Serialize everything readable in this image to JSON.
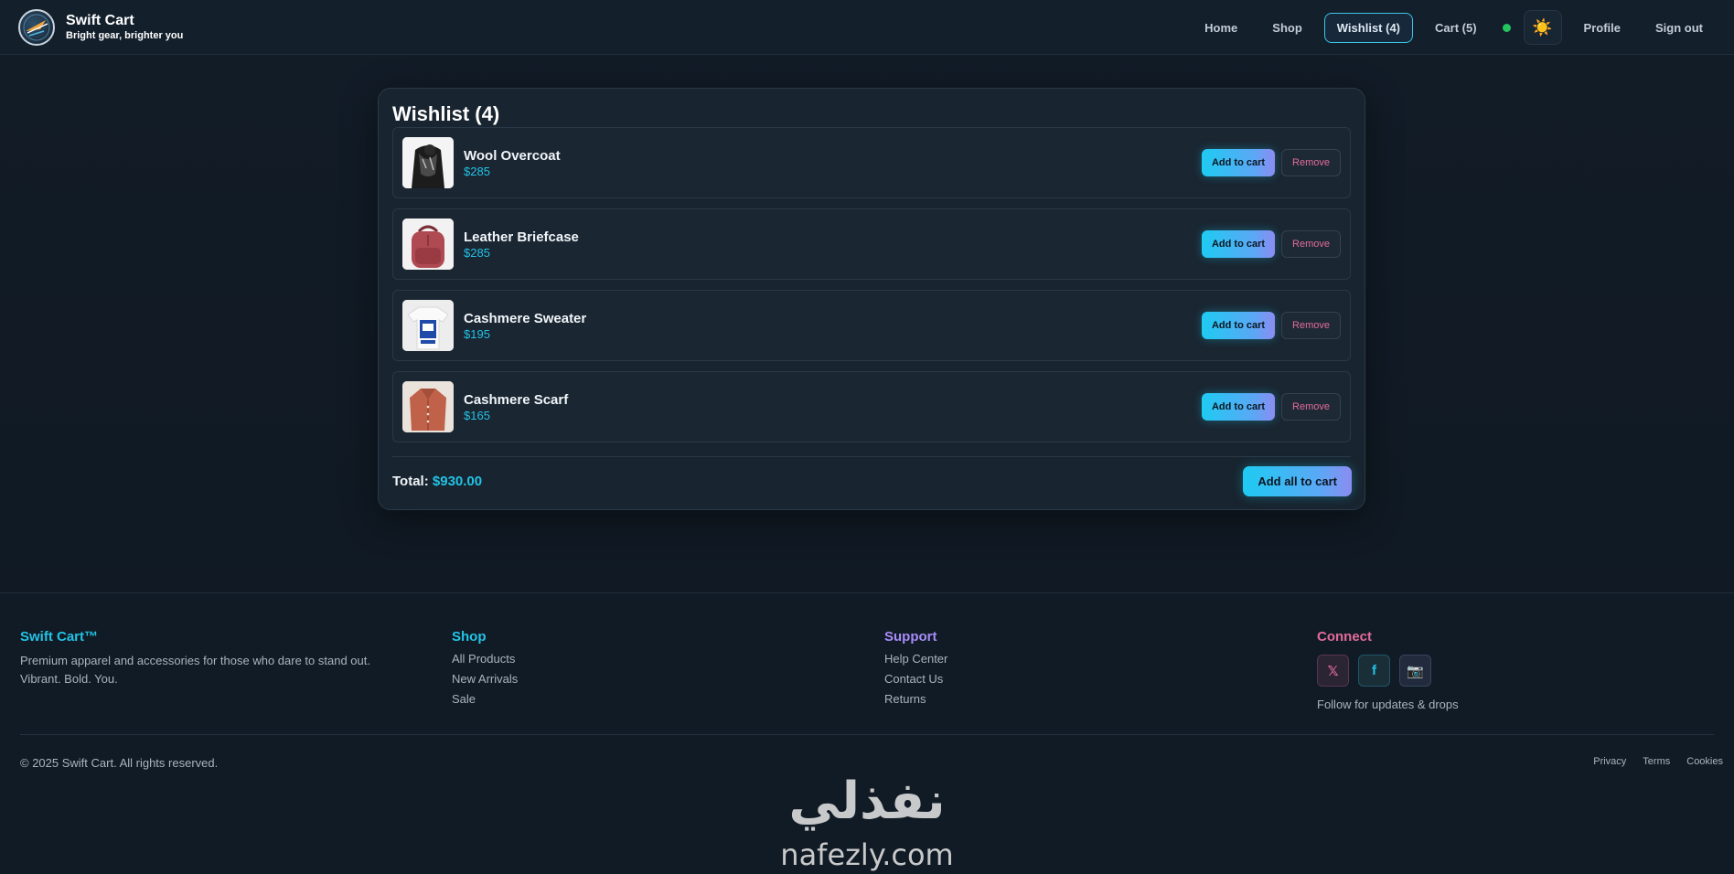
{
  "brand": {
    "name": "Swift Cart",
    "tagline": "Bright gear, brighter you"
  },
  "nav": {
    "home": "Home",
    "shop": "Shop",
    "wishlist": "Wishlist (4)",
    "cart": "Cart (5)",
    "theme_icon": "☀️",
    "profile": "Profile",
    "signout": "Sign out"
  },
  "wishlist": {
    "title": "Wishlist (4)",
    "items": [
      {
        "name": "Wool Overcoat",
        "price": "$285",
        "add_label": "Add to cart",
        "remove_label": "Remove"
      },
      {
        "name": "Leather Briefcase",
        "price": "$285",
        "add_label": "Add to cart",
        "remove_label": "Remove"
      },
      {
        "name": "Cashmere Sweater",
        "price": "$195",
        "add_label": "Add to cart",
        "remove_label": "Remove"
      },
      {
        "name": "Cashmere Scarf",
        "price": "$165",
        "add_label": "Add to cart",
        "remove_label": "Remove"
      }
    ],
    "total_label": "Total:",
    "total_value": "$930.00",
    "add_all_label": "Add all to cart"
  },
  "footer": {
    "brand": {
      "title": "Swift Cart™",
      "line1": "Premium apparel and accessories for those who dare to stand out.",
      "line2": "Vibrant. Bold. You."
    },
    "shop": {
      "title": "Shop",
      "links": [
        "All Products",
        "New Arrivals",
        "Sale"
      ]
    },
    "support": {
      "title": "Support",
      "links": [
        "Help Center",
        "Contact Us",
        "Returns"
      ]
    },
    "connect": {
      "title": "Connect",
      "x_icon": "𝕏",
      "fb_icon": "f",
      "ig_icon": "📷",
      "follow_text": "Follow for updates & drops"
    },
    "copyright": "© 2025 Swift Cart. All rights reserved.",
    "legal": [
      "Privacy",
      "Terms",
      "Cookies"
    ]
  },
  "watermark": {
    "arabic": "نفذلي",
    "latin": "nafezly.com"
  },
  "colors": {
    "accent_cyan": "#22c3e6",
    "accent_purple": "#a78bfa",
    "accent_pink": "#e46b9b",
    "status_green": "#22c55e"
  }
}
